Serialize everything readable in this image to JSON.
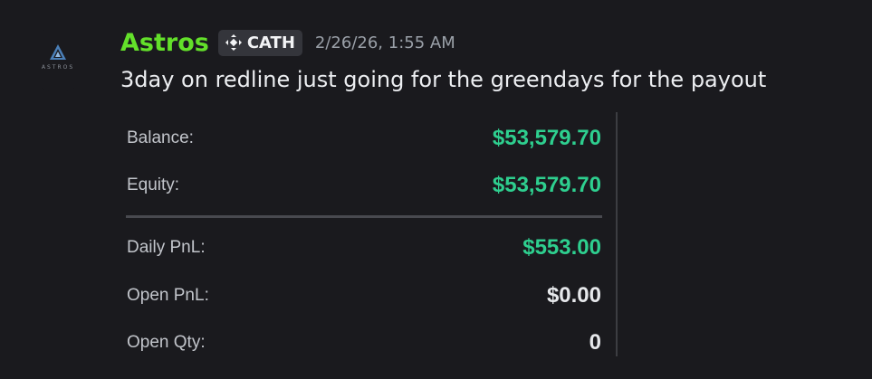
{
  "message": {
    "author": "Astros",
    "role_tag": "CATH",
    "timestamp": "2/26/26, 1:55 AM",
    "text": "3day on redline just going for the greendays for the payout",
    "avatar_text": "ASTROS"
  },
  "card": {
    "balance": {
      "label": "Balance:",
      "value": "$53,579.70",
      "color": "#2ecf8f"
    },
    "equity": {
      "label": "Equity:",
      "value": "$53,579.70",
      "color": "#2ecf8f"
    },
    "daily_pnl": {
      "label": "Daily PnL:",
      "value": "$553.00",
      "color": "#2ecf8f"
    },
    "open_pnl": {
      "label": "Open PnL:",
      "value": "$0.00",
      "color": "#e6e8eb"
    },
    "open_qty": {
      "label": "Open Qty:",
      "value": "0",
      "color": "#e6e8eb"
    }
  },
  "colors": {
    "username": "#63e02a",
    "background": "#1a1a1e",
    "positive": "#2ecf8f"
  },
  "icons": {
    "avatar": "astros-logo-icon",
    "tag": "diamond-arrows-icon"
  }
}
